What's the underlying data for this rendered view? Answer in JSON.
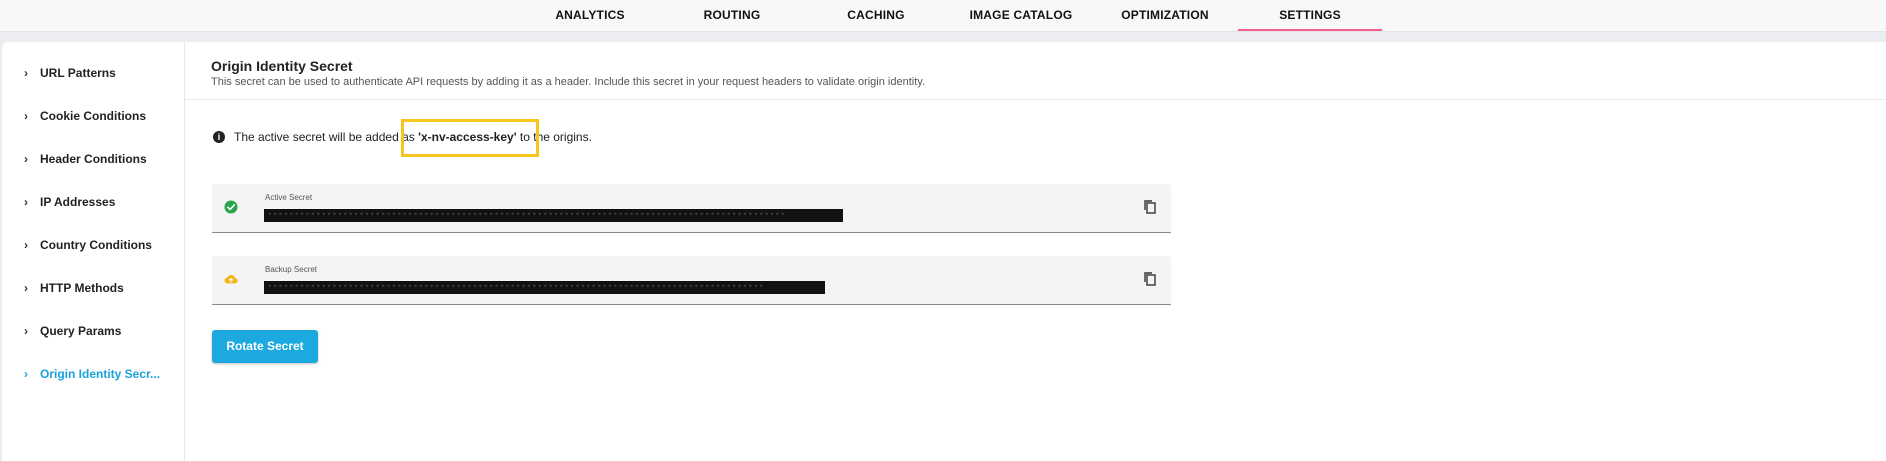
{
  "nav": {
    "tabs": [
      {
        "label": "ANALYTICS"
      },
      {
        "label": "ROUTING"
      },
      {
        "label": "CACHING"
      },
      {
        "label": "IMAGE CATALOG"
      },
      {
        "label": "OPTIMIZATION"
      },
      {
        "label": "SETTINGS",
        "active": true
      }
    ],
    "active_underline_color": "#f2608a"
  },
  "sidebar": {
    "items": [
      {
        "label": "URL Patterns"
      },
      {
        "label": "Cookie Conditions"
      },
      {
        "label": "Header Conditions"
      },
      {
        "label": "IP Addresses"
      },
      {
        "label": "Country Conditions"
      },
      {
        "label": "HTTP Methods"
      },
      {
        "label": "Query Params"
      },
      {
        "label": "Origin Identity Secr...",
        "active": true
      }
    ],
    "active_color": "#1aa0db"
  },
  "main": {
    "title": "Origin Identity Secret",
    "description": "This secret can be used to authenticate API requests by adding it as a header. Include this secret in your request headers to validate origin identity.",
    "info": {
      "icon": "info-icon",
      "prefix": "The active secret will be added as",
      "key": "'x-nv-access-key'",
      "suffix": "to the origins."
    },
    "active_secret": {
      "label": "Active Secret",
      "status_icon": "check-circle-icon",
      "status_color": "#2aa54a",
      "value": "••••••••••••••••••••••••••••••••••••••••••••••••••••••••••••••••••••••••••••••••••••••••••••••••",
      "copy_icon": "copy-icon"
    },
    "backup_secret": {
      "label": "Backup Secret",
      "status_icon": "cloud-upload-icon",
      "status_color": "#f5b31a",
      "value": "••••••••••••••••••••••••••••••••••••••••••••••••••••••••••••••••••••••••••••••••••••••••••••",
      "copy_icon": "copy-icon"
    },
    "rotate_button": {
      "label": "Rotate Secret",
      "color": "#1ba9e0"
    }
  }
}
